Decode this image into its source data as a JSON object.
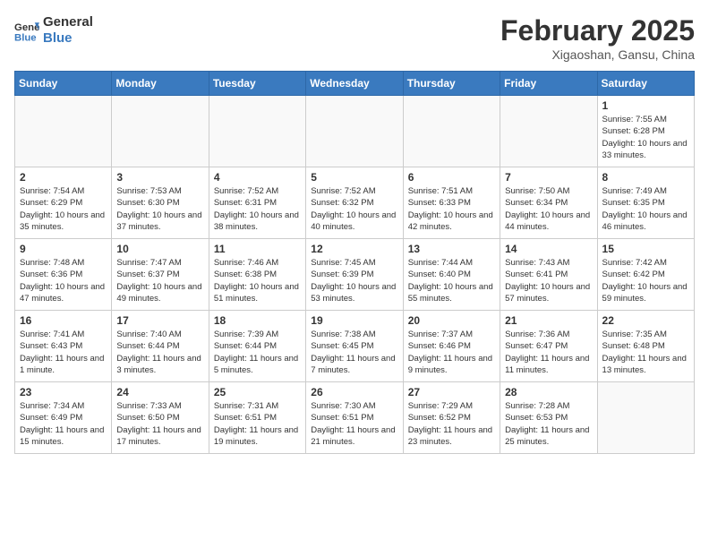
{
  "header": {
    "logo_line1": "General",
    "logo_line2": "Blue",
    "month_title": "February 2025",
    "location": "Xigaoshan, Gansu, China"
  },
  "weekdays": [
    "Sunday",
    "Monday",
    "Tuesday",
    "Wednesday",
    "Thursday",
    "Friday",
    "Saturday"
  ],
  "weeks": [
    [
      {
        "day": "",
        "info": ""
      },
      {
        "day": "",
        "info": ""
      },
      {
        "day": "",
        "info": ""
      },
      {
        "day": "",
        "info": ""
      },
      {
        "day": "",
        "info": ""
      },
      {
        "day": "",
        "info": ""
      },
      {
        "day": "1",
        "info": "Sunrise: 7:55 AM\nSunset: 6:28 PM\nDaylight: 10 hours and 33 minutes."
      }
    ],
    [
      {
        "day": "2",
        "info": "Sunrise: 7:54 AM\nSunset: 6:29 PM\nDaylight: 10 hours and 35 minutes."
      },
      {
        "day": "3",
        "info": "Sunrise: 7:53 AM\nSunset: 6:30 PM\nDaylight: 10 hours and 37 minutes."
      },
      {
        "day": "4",
        "info": "Sunrise: 7:52 AM\nSunset: 6:31 PM\nDaylight: 10 hours and 38 minutes."
      },
      {
        "day": "5",
        "info": "Sunrise: 7:52 AM\nSunset: 6:32 PM\nDaylight: 10 hours and 40 minutes."
      },
      {
        "day": "6",
        "info": "Sunrise: 7:51 AM\nSunset: 6:33 PM\nDaylight: 10 hours and 42 minutes."
      },
      {
        "day": "7",
        "info": "Sunrise: 7:50 AM\nSunset: 6:34 PM\nDaylight: 10 hours and 44 minutes."
      },
      {
        "day": "8",
        "info": "Sunrise: 7:49 AM\nSunset: 6:35 PM\nDaylight: 10 hours and 46 minutes."
      }
    ],
    [
      {
        "day": "9",
        "info": "Sunrise: 7:48 AM\nSunset: 6:36 PM\nDaylight: 10 hours and 47 minutes."
      },
      {
        "day": "10",
        "info": "Sunrise: 7:47 AM\nSunset: 6:37 PM\nDaylight: 10 hours and 49 minutes."
      },
      {
        "day": "11",
        "info": "Sunrise: 7:46 AM\nSunset: 6:38 PM\nDaylight: 10 hours and 51 minutes."
      },
      {
        "day": "12",
        "info": "Sunrise: 7:45 AM\nSunset: 6:39 PM\nDaylight: 10 hours and 53 minutes."
      },
      {
        "day": "13",
        "info": "Sunrise: 7:44 AM\nSunset: 6:40 PM\nDaylight: 10 hours and 55 minutes."
      },
      {
        "day": "14",
        "info": "Sunrise: 7:43 AM\nSunset: 6:41 PM\nDaylight: 10 hours and 57 minutes."
      },
      {
        "day": "15",
        "info": "Sunrise: 7:42 AM\nSunset: 6:42 PM\nDaylight: 10 hours and 59 minutes."
      }
    ],
    [
      {
        "day": "16",
        "info": "Sunrise: 7:41 AM\nSunset: 6:43 PM\nDaylight: 11 hours and 1 minute."
      },
      {
        "day": "17",
        "info": "Sunrise: 7:40 AM\nSunset: 6:44 PM\nDaylight: 11 hours and 3 minutes."
      },
      {
        "day": "18",
        "info": "Sunrise: 7:39 AM\nSunset: 6:44 PM\nDaylight: 11 hours and 5 minutes."
      },
      {
        "day": "19",
        "info": "Sunrise: 7:38 AM\nSunset: 6:45 PM\nDaylight: 11 hours and 7 minutes."
      },
      {
        "day": "20",
        "info": "Sunrise: 7:37 AM\nSunset: 6:46 PM\nDaylight: 11 hours and 9 minutes."
      },
      {
        "day": "21",
        "info": "Sunrise: 7:36 AM\nSunset: 6:47 PM\nDaylight: 11 hours and 11 minutes."
      },
      {
        "day": "22",
        "info": "Sunrise: 7:35 AM\nSunset: 6:48 PM\nDaylight: 11 hours and 13 minutes."
      }
    ],
    [
      {
        "day": "23",
        "info": "Sunrise: 7:34 AM\nSunset: 6:49 PM\nDaylight: 11 hours and 15 minutes."
      },
      {
        "day": "24",
        "info": "Sunrise: 7:33 AM\nSunset: 6:50 PM\nDaylight: 11 hours and 17 minutes."
      },
      {
        "day": "25",
        "info": "Sunrise: 7:31 AM\nSunset: 6:51 PM\nDaylight: 11 hours and 19 minutes."
      },
      {
        "day": "26",
        "info": "Sunrise: 7:30 AM\nSunset: 6:51 PM\nDaylight: 11 hours and 21 minutes."
      },
      {
        "day": "27",
        "info": "Sunrise: 7:29 AM\nSunset: 6:52 PM\nDaylight: 11 hours and 23 minutes."
      },
      {
        "day": "28",
        "info": "Sunrise: 7:28 AM\nSunset: 6:53 PM\nDaylight: 11 hours and 25 minutes."
      },
      {
        "day": "",
        "info": ""
      }
    ]
  ]
}
